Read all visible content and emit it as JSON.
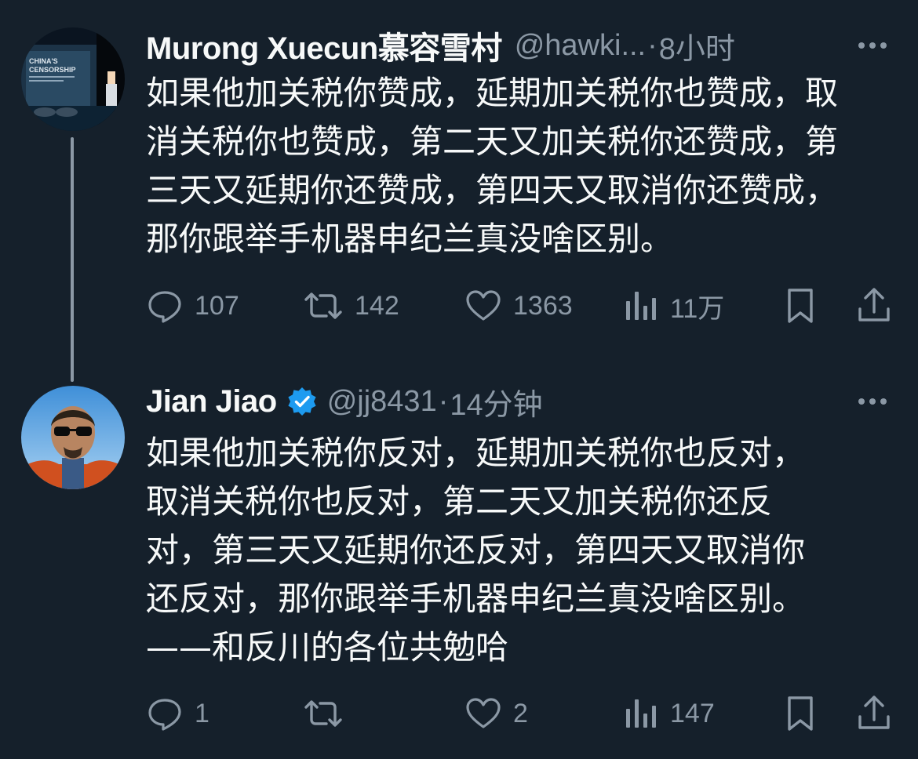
{
  "tweets": [
    {
      "display_name": "Murong Xuecun慕容雪村",
      "handle": "@hawki...",
      "separator": "·",
      "time": "8小时",
      "verified": false,
      "content_lines": [
        "如果他加关税你赞成，延期加关税你也赞成，取",
        "消关税你也赞成，第二天又加关税你还赞成，第",
        "三天又延期你还赞成，第四天又取消你还赞成，",
        "那你跟举手机器申纪兰真没啥区别。"
      ],
      "avatar_text": [
        "CHINA'S",
        "CENSORSHIP"
      ],
      "stats": {
        "replies": "107",
        "retweets": "142",
        "likes": "1363",
        "views": "11万"
      }
    },
    {
      "display_name": "Jian Jiao",
      "handle": "@jj8431",
      "separator": "·",
      "time": "14分钟",
      "verified": true,
      "content_lines": [
        "如果他加关税你反对，延期加关税你也反对，",
        "取消关税你也反对，第二天又加关税你还反",
        "对，第三天又延期你还反对，第四天又取消你",
        "还反对，那你跟举手机器申纪兰真没啥区别。",
        "——和反川的各位共勉哈"
      ],
      "stats": {
        "replies": "1",
        "retweets": "",
        "likes": "2",
        "views": "147"
      }
    }
  ],
  "colors": {
    "background": "#15202b",
    "text_primary": "#f7f9f9",
    "text_secondary": "#8b98a5",
    "verified_badge": "#1d9bf0",
    "thread_line": "#8b98a5"
  },
  "icons": {
    "reply": "reply-icon",
    "retweet": "retweet-icon",
    "like": "heart-icon",
    "views": "views-icon",
    "bookmark": "bookmark-icon",
    "share": "share-icon",
    "more": "more-icon",
    "verified": "verified-icon"
  }
}
